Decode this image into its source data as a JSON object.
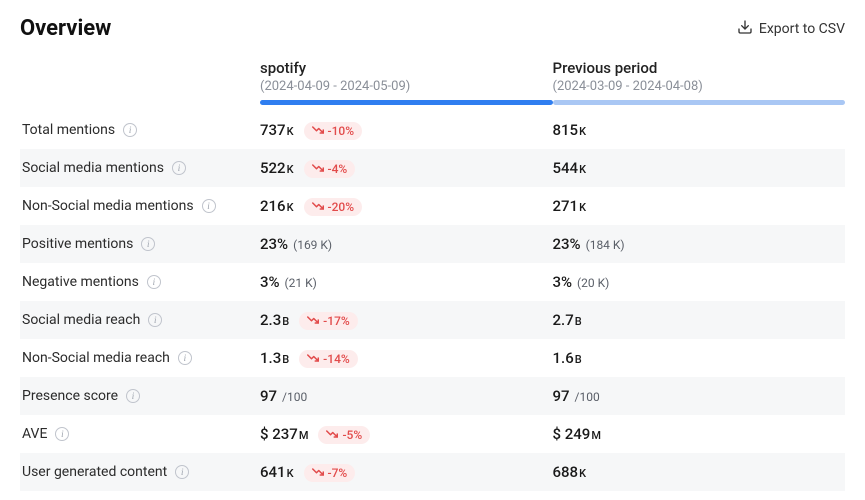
{
  "header": {
    "title": "Overview",
    "export_label": "Export to CSV"
  },
  "columns": {
    "current": {
      "name": "spotify",
      "range": "(2024-04-09 - 2024-05-09)"
    },
    "previous": {
      "name": "Previous period",
      "range": "(2024-03-09 - 2024-04-08)"
    }
  },
  "rows": [
    {
      "label": "Total mentions",
      "cur_num": "737",
      "cur_unit": "K",
      "cur_sub": "",
      "delta": "-10%",
      "prev_num": "815",
      "prev_unit": "K",
      "prev_sub": ""
    },
    {
      "label": "Social media mentions",
      "cur_num": "522",
      "cur_unit": "K",
      "cur_sub": "",
      "delta": "-4%",
      "prev_num": "544",
      "prev_unit": "K",
      "prev_sub": ""
    },
    {
      "label": "Non-Social media mentions",
      "cur_num": "216",
      "cur_unit": "K",
      "cur_sub": "",
      "delta": "-20%",
      "prev_num": "271",
      "prev_unit": "K",
      "prev_sub": ""
    },
    {
      "label": "Positive mentions",
      "cur_num": "23%",
      "cur_unit": "",
      "cur_sub": "(169 K)",
      "delta": "",
      "prev_num": "23%",
      "prev_unit": "",
      "prev_sub": "(184 K)"
    },
    {
      "label": "Negative mentions",
      "cur_num": "3%",
      "cur_unit": "",
      "cur_sub": "(21 K)",
      "delta": "",
      "prev_num": "3%",
      "prev_unit": "",
      "prev_sub": "(20 K)"
    },
    {
      "label": "Social media reach",
      "cur_num": "2.3",
      "cur_unit": "B",
      "cur_sub": "",
      "delta": "-17%",
      "prev_num": "2.7",
      "prev_unit": "B",
      "prev_sub": ""
    },
    {
      "label": "Non-Social media reach",
      "cur_num": "1.3",
      "cur_unit": "B",
      "cur_sub": "",
      "delta": "-14%",
      "prev_num": "1.6",
      "prev_unit": "B",
      "prev_sub": ""
    },
    {
      "label": "Presence score",
      "cur_num": "97",
      "cur_unit": "",
      "cur_sub": "/100",
      "delta": "",
      "prev_num": "97",
      "prev_unit": "",
      "prev_sub": "/100"
    },
    {
      "label": "AVE",
      "cur_num": "$ 237",
      "cur_unit": "M",
      "cur_sub": "",
      "delta": "-5%",
      "prev_num": "$ 249",
      "prev_unit": "M",
      "prev_sub": ""
    },
    {
      "label": "User generated content",
      "cur_num": "641",
      "cur_unit": "K",
      "cur_sub": "",
      "delta": "-7%",
      "prev_num": "688",
      "prev_unit": "K",
      "prev_sub": ""
    }
  ]
}
